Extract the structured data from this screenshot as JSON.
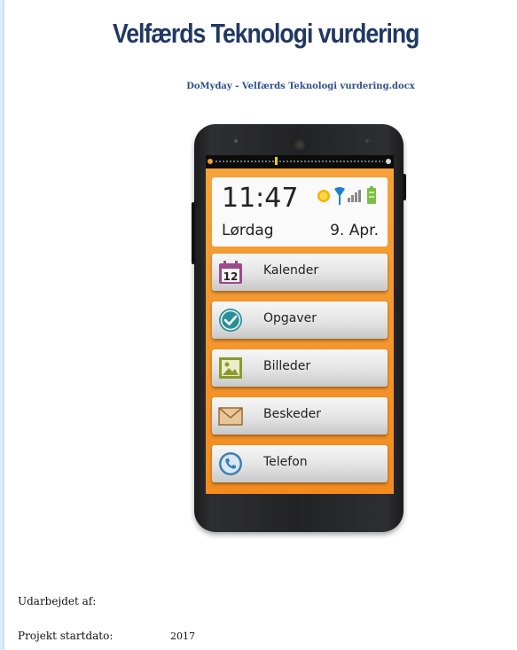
{
  "document": {
    "title": "Velfærds Teknologi vurdering",
    "subtitle": "DoMyday - Velfærds Teknologi vurdering.docx"
  },
  "phone": {
    "time": "11:47",
    "day": "Lørdag",
    "date": "9. Apr.",
    "apps": [
      {
        "label": "Kalender",
        "icon": "calendar-icon",
        "icon_text": "12"
      },
      {
        "label": "Opgaver",
        "icon": "checkmark-icon"
      },
      {
        "label": "Billeder",
        "icon": "picture-icon"
      },
      {
        "label": "Beskeder",
        "icon": "envelope-icon"
      },
      {
        "label": "Telefon",
        "icon": "phone-icon"
      }
    ],
    "colors": {
      "background": "#f28c1f",
      "accent_teal": "#2a8f97"
    }
  },
  "fields": {
    "prepared_by_label": "Udarbejdet af:",
    "start_date_label": "Projekt startdato:",
    "start_date_value": "2017"
  }
}
